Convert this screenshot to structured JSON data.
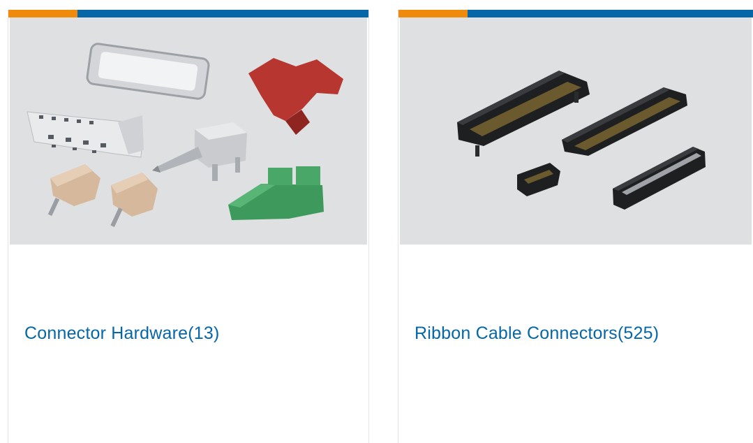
{
  "colors": {
    "accent_orange": "#f08a0c",
    "brand_blue": "#0667a8"
  },
  "cards": [
    {
      "title": "Connector Hardware(13)",
      "image_icon": "connector-hardware-product-photo"
    },
    {
      "title": "Ribbon Cable Connectors(525)",
      "image_icon": "ribbon-cable-connectors-product-photo"
    }
  ]
}
